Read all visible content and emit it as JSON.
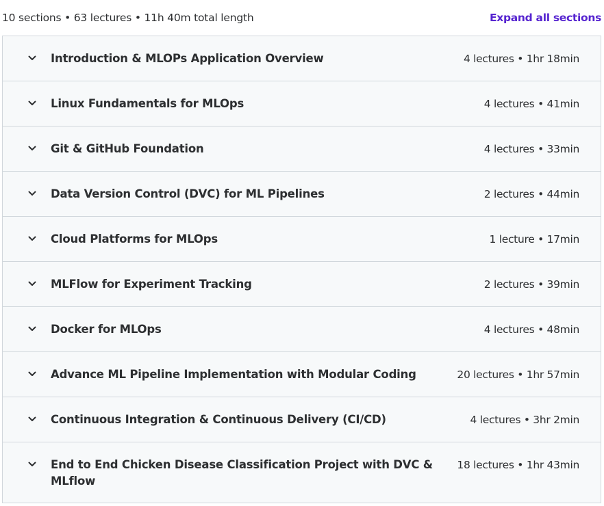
{
  "header": {
    "summary": "10 sections • 63 lectures • 11h 40m total length",
    "expand_all_label": "Expand all sections"
  },
  "icons": {
    "section_toggle": "chevron-down-icon"
  },
  "colors": {
    "accent": "#5624d0",
    "section_bg": "#f7f9fa",
    "border": "#d1d7dc",
    "text": "#2d2f31"
  },
  "sections": [
    {
      "title": "Introduction & MLOPs Application Overview",
      "meta": "4 lectures • 1hr 18min"
    },
    {
      "title": "Linux Fundamentals for MLOps",
      "meta": "4 lectures • 41min"
    },
    {
      "title": "Git & GitHub Foundation",
      "meta": "4 lectures • 33min"
    },
    {
      "title": "Data Version Control (DVC) for ML Pipelines",
      "meta": "2 lectures • 44min"
    },
    {
      "title": "Cloud Platforms for MLOps",
      "meta": "1 lecture • 17min"
    },
    {
      "title": "MLFlow for Experiment Tracking",
      "meta": "2 lectures • 39min"
    },
    {
      "title": "Docker for MLOps",
      "meta": "4 lectures • 48min"
    },
    {
      "title": "Advance ML Pipeline Implementation with Modular Coding",
      "meta": "20 lectures • 1hr 57min"
    },
    {
      "title": "Continuous Integration & Continuous Delivery (CI/CD)",
      "meta": "4 lectures • 3hr 2min"
    },
    {
      "title": "End to End Chicken Disease Classification Project with DVC & MLflow",
      "meta": "18 lectures • 1hr 43min"
    }
  ]
}
